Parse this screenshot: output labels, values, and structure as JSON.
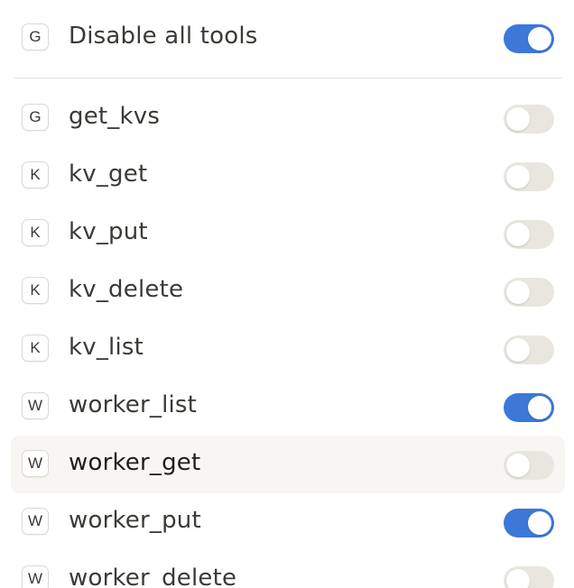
{
  "colors": {
    "toggle_on": "#3b78d8",
    "toggle_off": "#e8e6df",
    "hover_row": "#f7f6f2"
  },
  "master": {
    "badge": "G",
    "label": "Disable all tools",
    "enabled": true
  },
  "tools": [
    {
      "badge": "G",
      "label": "get_kvs",
      "enabled": false
    },
    {
      "badge": "K",
      "label": "kv_get",
      "enabled": false
    },
    {
      "badge": "K",
      "label": "kv_put",
      "enabled": false
    },
    {
      "badge": "K",
      "label": "kv_delete",
      "enabled": false
    },
    {
      "badge": "K",
      "label": "kv_list",
      "enabled": false
    },
    {
      "badge": "W",
      "label": "worker_list",
      "enabled": true
    },
    {
      "badge": "W",
      "label": "worker_get",
      "enabled": false
    },
    {
      "badge": "W",
      "label": "worker_put",
      "enabled": true
    },
    {
      "badge": "W",
      "label": "worker_delete",
      "enabled": false
    }
  ]
}
